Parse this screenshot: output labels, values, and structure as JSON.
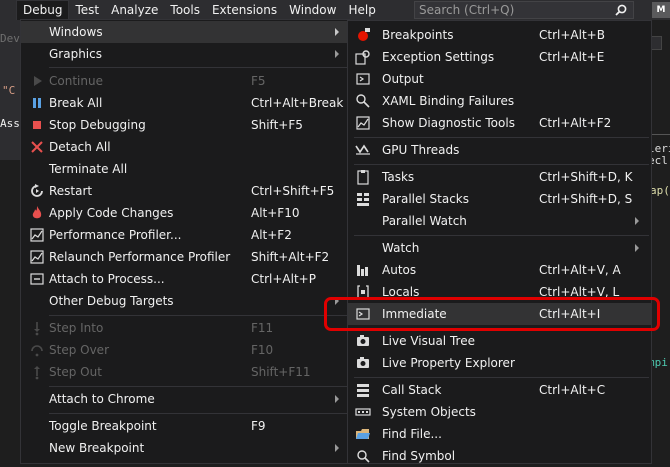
{
  "menubar": {
    "items": [
      "Debug",
      "Test",
      "Analyze",
      "Tools",
      "Extensions",
      "Window",
      "Help"
    ],
    "search_placeholder": "Search (Ctrl+Q)",
    "corner_label": "M"
  },
  "background": {
    "dev_text": "Dev",
    "quote_text": "\"C",
    "ass_text": "Ass",
    "right_text1": "lerin",
    "right_text2": "ecl",
    "right_text3": "ap(",
    "right_text4": "mpi"
  },
  "debug_menu": {
    "items": [
      {
        "label": "Windows",
        "shortcut": "",
        "submenu": true,
        "disabled": false,
        "icon": ""
      },
      {
        "label": "Graphics",
        "shortcut": "",
        "submenu": true,
        "disabled": false,
        "icon": ""
      },
      {
        "label": "Continue",
        "shortcut": "F5",
        "disabled": true,
        "icon": "play-icon"
      },
      {
        "label": "Break All",
        "shortcut": "Ctrl+Alt+Break",
        "disabled": false,
        "icon": "pause-icon"
      },
      {
        "label": "Stop Debugging",
        "shortcut": "Shift+F5",
        "disabled": false,
        "icon": "stop-icon"
      },
      {
        "label": "Detach All",
        "shortcut": "",
        "disabled": false,
        "icon": "x-icon"
      },
      {
        "label": "Terminate All",
        "shortcut": "",
        "disabled": false,
        "icon": ""
      },
      {
        "label": "Restart",
        "shortcut": "Ctrl+Shift+F5",
        "disabled": false,
        "icon": "restart-icon"
      },
      {
        "label": "Apply Code Changes",
        "shortcut": "Alt+F10",
        "disabled": false,
        "icon": "flame-icon"
      },
      {
        "label": "Performance Profiler...",
        "shortcut": "Alt+F2",
        "disabled": false,
        "icon": "chart-icon"
      },
      {
        "label": "Relaunch Performance Profiler",
        "shortcut": "Shift+Alt+F2",
        "disabled": false,
        "icon": "chart-icon"
      },
      {
        "label": "Attach to Process...",
        "shortcut": "Ctrl+Alt+P",
        "disabled": false,
        "icon": "attach-icon"
      },
      {
        "label": "Other Debug Targets",
        "shortcut": "",
        "submenu": true,
        "disabled": false,
        "icon": ""
      },
      {
        "label": "Step Into",
        "shortcut": "F11",
        "disabled": true,
        "icon": "step-into-icon"
      },
      {
        "label": "Step Over",
        "shortcut": "F10",
        "disabled": true,
        "icon": "step-over-icon"
      },
      {
        "label": "Step Out",
        "shortcut": "Shift+F11",
        "disabled": true,
        "icon": "step-out-icon"
      },
      {
        "label": "Attach to Chrome",
        "shortcut": "",
        "submenu": true,
        "disabled": false,
        "icon": ""
      },
      {
        "label": "Toggle Breakpoint",
        "shortcut": "F9",
        "disabled": false,
        "icon": ""
      },
      {
        "label": "New Breakpoint",
        "shortcut": "",
        "submenu": true,
        "disabled": false,
        "icon": ""
      }
    ]
  },
  "windows_menu": {
    "items": [
      {
        "label": "Breakpoints",
        "shortcut": "Ctrl+Alt+B",
        "icon": "breakpoint-icon"
      },
      {
        "label": "Exception Settings",
        "shortcut": "Ctrl+Alt+E",
        "icon": "exception-settings-icon"
      },
      {
        "label": "Output",
        "shortcut": "",
        "icon": "output-icon"
      },
      {
        "label": "XAML Binding Failures",
        "shortcut": "",
        "icon": "xaml-binding-icon"
      },
      {
        "label": "Show Diagnostic Tools",
        "shortcut": "Ctrl+Alt+F2",
        "icon": "diagnostic-icon"
      },
      {
        "label": "GPU Threads",
        "shortcut": "",
        "icon": "gpu-threads-icon"
      },
      {
        "label": "Tasks",
        "shortcut": "Ctrl+Shift+D, K",
        "icon": "tasks-icon"
      },
      {
        "label": "Parallel Stacks",
        "shortcut": "Ctrl+Shift+D, S",
        "icon": "parallel-stacks-icon"
      },
      {
        "label": "Parallel Watch",
        "shortcut": "",
        "icon": "",
        "submenu": true
      },
      {
        "label": "Watch",
        "shortcut": "",
        "icon": "",
        "submenu": true
      },
      {
        "label": "Autos",
        "shortcut": "Ctrl+Alt+V, A",
        "icon": "autos-icon"
      },
      {
        "label": "Locals",
        "shortcut": "Ctrl+Alt+V, L",
        "icon": "locals-icon"
      },
      {
        "label": "Immediate",
        "shortcut": "Ctrl+Alt+I",
        "icon": "immediate-icon"
      },
      {
        "label": "Live Visual Tree",
        "shortcut": "",
        "icon": "camera-icon"
      },
      {
        "label": "Live Property Explorer",
        "shortcut": "",
        "icon": "camera-icon"
      },
      {
        "label": "Call Stack",
        "shortcut": "Ctrl+Alt+C",
        "icon": "call-stack-icon"
      },
      {
        "label": "System Objects",
        "shortcut": "",
        "icon": "system-objects-icon"
      },
      {
        "label": "Find File...",
        "shortcut": "",
        "icon": "find-file-icon"
      },
      {
        "label": "Find Symbol",
        "shortcut": "",
        "icon": "find-symbol-icon"
      }
    ]
  },
  "colors": {
    "menu_bg": "#1b1b1c",
    "highlight": "#333334",
    "callout_border": "#e00000",
    "stop_red": "#e8504e",
    "pause_blue": "#5aa1e3"
  }
}
